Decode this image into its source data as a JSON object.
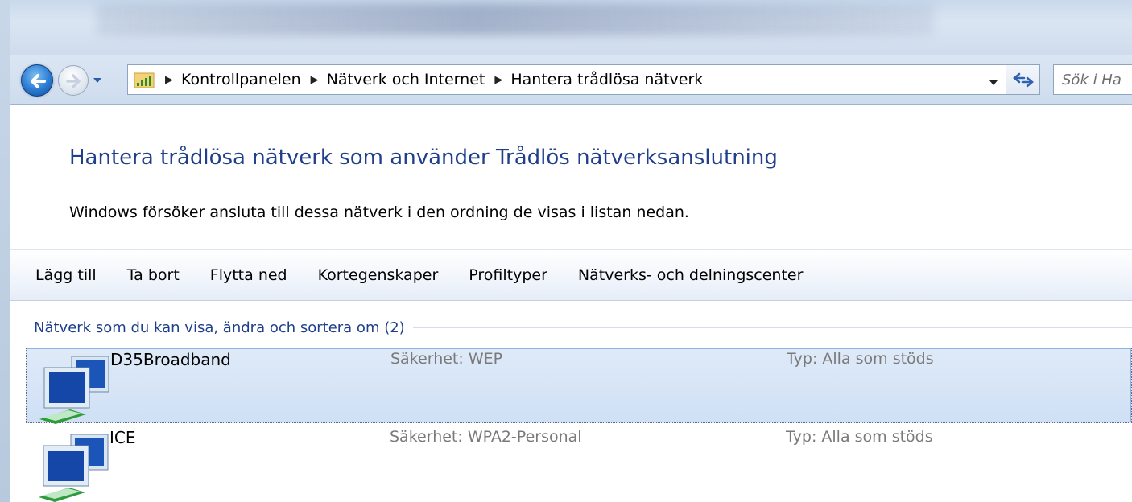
{
  "address_bar": {
    "breadcrumbs": [
      "Kontrollpanelen",
      "Nätverk och Internet",
      "Hantera trådlösa nätverk"
    ],
    "search_placeholder": "Sök i Ha"
  },
  "main": {
    "heading": "Hantera trådlösa nätverk som använder Trådlös nätverksanslutning",
    "description": "Windows försöker ansluta till dessa nätverk i den ordning de visas i listan nedan."
  },
  "toolbar": {
    "buttons": [
      "Lägg till",
      "Ta bort",
      "Flytta ned",
      "Kortegenskaper",
      "Profiltyper",
      "Nätverks- och delningscenter"
    ]
  },
  "network_list": {
    "group_title": "Nätverk som du kan visa, ändra och sortera om (2)",
    "items": [
      {
        "name": "D35Broadband",
        "security": "Säkerhet:  WEP",
        "type": "Typ:  Alla som stöds",
        "selected": true
      },
      {
        "name": "ICE",
        "security": "Säkerhet:  WPA2-Personal",
        "type": "Typ:  Alla som stöds",
        "selected": false
      }
    ]
  },
  "colors": {
    "heading": "#1f3f8c",
    "selection": "#cfe0f5",
    "secondary_text": "#7a7a7a"
  },
  "icons": {
    "back": "back-arrow-icon",
    "forward": "forward-arrow-icon",
    "address": "network-signal-icon",
    "refresh": "refresh-icon",
    "network": "wireless-network-computers-icon"
  }
}
